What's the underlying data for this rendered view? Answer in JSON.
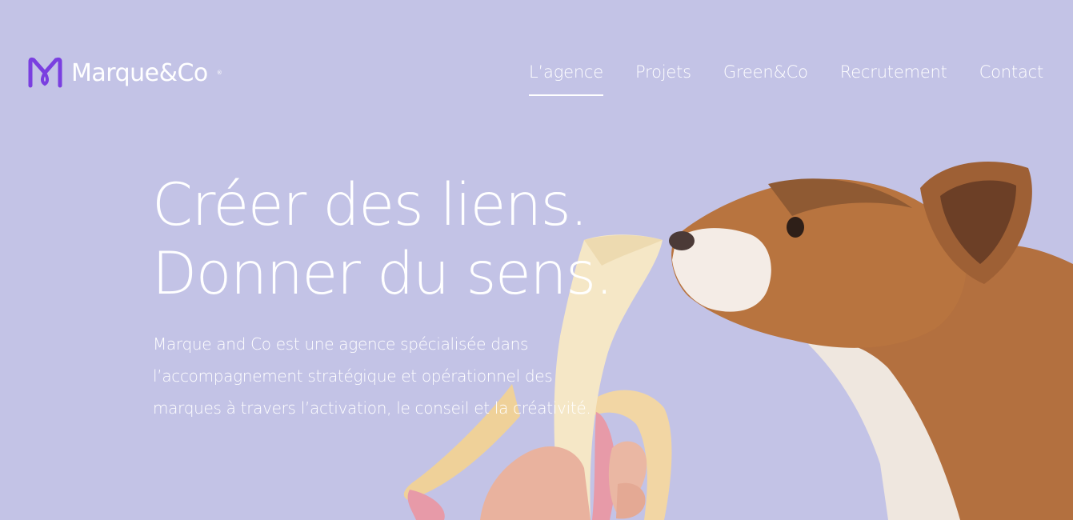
{
  "brand": {
    "name": "Marque&Co",
    "registered": "®",
    "accent_color": "#7a3fe0"
  },
  "nav": {
    "items": [
      {
        "label": "L’agence",
        "active": true
      },
      {
        "label": "Projets",
        "active": false
      },
      {
        "label": "Green&Co",
        "active": false
      },
      {
        "label": "Recrutement",
        "active": false
      },
      {
        "label": "Contact",
        "active": false
      }
    ]
  },
  "hero": {
    "headline_line1": "Créer des liens.",
    "headline_line2": "Donner du sens.",
    "intro": "Marque and Co est une agence spécialisée dans l’accompagnement stratégique et opérationnel des marques à travers l’activation, le conseil et la créativité.",
    "background_color": "#c3c3e6",
    "image": "dog-sniffing-banana-photo"
  }
}
